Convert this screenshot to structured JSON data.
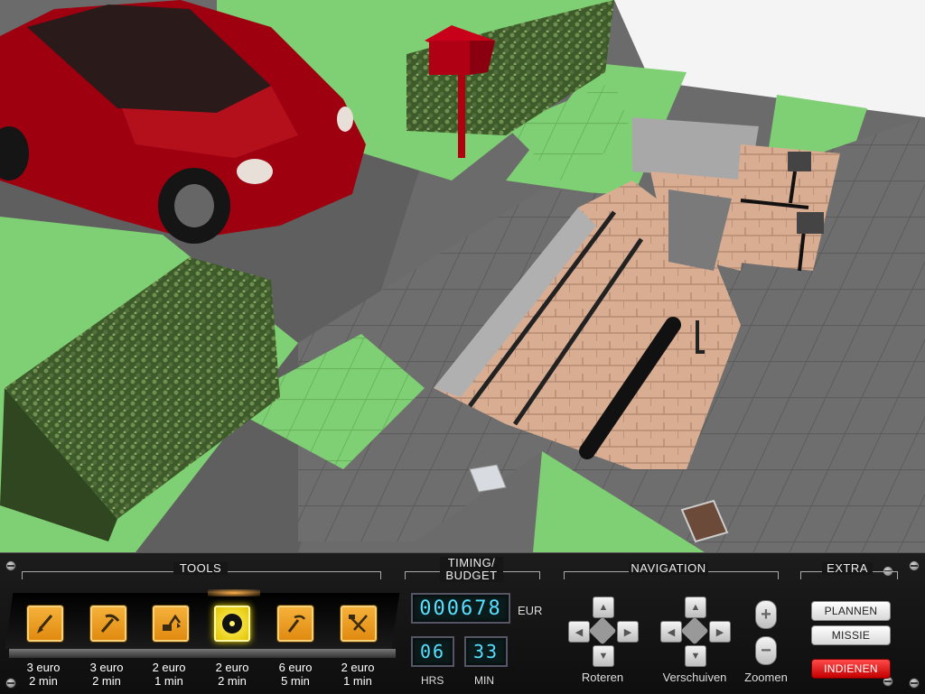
{
  "hud": {
    "tools_title": "TOOLS",
    "timing_title_line1": "TIMING/",
    "timing_title_line2": "BUDGET",
    "navigation_title": "NAVIGATION",
    "extra_title": "EXTRA",
    "tools": [
      {
        "icon": "shovel-icon",
        "cost": "3 euro",
        "time": "2 min"
      },
      {
        "icon": "pickaxe-icon",
        "cost": "3 euro",
        "time": "2 min"
      },
      {
        "icon": "excavator-icon",
        "cost": "2 euro",
        "time": "1 min"
      },
      {
        "icon": "saw-blade-icon",
        "cost": "2 euro",
        "time": "2 min",
        "active": true
      },
      {
        "icon": "jackhammer-icon",
        "cost": "6 euro",
        "time": "5 min"
      },
      {
        "icon": "hammer-shovel-icon",
        "cost": "2 euro",
        "time": "1 min"
      }
    ],
    "budget_value": "000678",
    "budget_unit": "EUR",
    "hours_value": "06",
    "hours_label": "HRS",
    "minutes_value": "33",
    "minutes_label": "MIN",
    "rotate_label": "Roteren",
    "move_label": "Verschuiven",
    "zoom_label": "Zoomen",
    "plan_button": "PLANNEN",
    "mission_button": "MISSIE",
    "submit_button": "INDIENEN"
  }
}
